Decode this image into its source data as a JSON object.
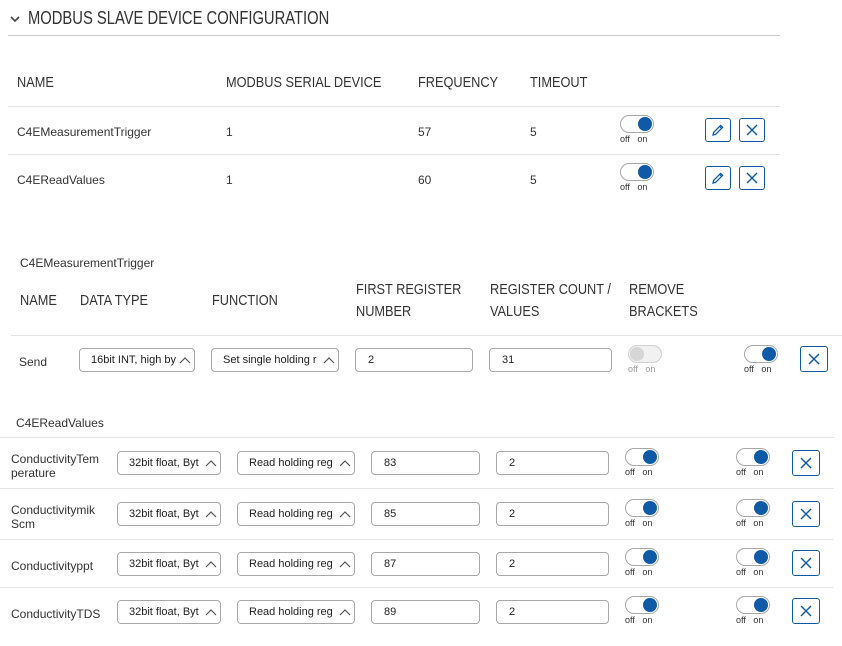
{
  "section": {
    "title": "MODBUS SLAVE DEVICE CONFIGURATION"
  },
  "devices": {
    "headers": [
      "NAME",
      "MODBUS SERIAL DEVICE",
      "FREQUENCY",
      "TIMEOUT"
    ],
    "rows": [
      {
        "name": "C4EMeasurementTrigger",
        "serial": "1",
        "frequency": "57",
        "timeout": "5",
        "enabled": true
      },
      {
        "name": "C4EReadValues",
        "serial": "1",
        "frequency": "60",
        "timeout": "5",
        "enabled": true
      }
    ]
  },
  "toggle_labels": {
    "off": "off",
    "on": "on"
  },
  "trigger": {
    "title": "C4EMeasurementTrigger",
    "headers": {
      "name": "NAME",
      "data_type": "DATA TYPE",
      "function": "FUNCTION",
      "first_register_1": "FIRST REGISTER",
      "first_register_2": "NUMBER",
      "register_count_1": "REGISTER COUNT /",
      "register_count_2": "VALUES",
      "remove_brackets_1": "REMOVE",
      "remove_brackets_2": "BRACKETS"
    },
    "rows": [
      {
        "name": "Send",
        "data_type": "16bit INT, high by",
        "function": "Set single holding r",
        "first_register": "2",
        "register_count": "31",
        "remove_brackets": false,
        "enabled": true
      }
    ]
  },
  "readvalues": {
    "title": "C4EReadValues",
    "rows": [
      {
        "name_1": "ConductivityTem",
        "name_2": "perature",
        "data_type": "32bit float, Byt",
        "function": "Read holding reg",
        "first_register": "83",
        "register_count": "2",
        "remove_brackets": true,
        "enabled": true
      },
      {
        "name_1": "Conductivitymik",
        "name_2": "Scm",
        "data_type": "32bit float, Byt",
        "function": "Read holding reg",
        "first_register": "85",
        "register_count": "2",
        "remove_brackets": true,
        "enabled": true
      },
      {
        "name_1": "Conductivityppt",
        "name_2": "",
        "data_type": "32bit float, Byt",
        "function": "Read holding reg",
        "first_register": "87",
        "register_count": "2",
        "remove_brackets": true,
        "enabled": true
      },
      {
        "name_1": "ConductivityTDS",
        "name_2": "",
        "data_type": "32bit float, Byt",
        "function": "Read holding reg",
        "first_register": "89",
        "register_count": "2",
        "remove_brackets": true,
        "enabled": true
      }
    ]
  },
  "colors": {
    "accent": "#0e5aa7",
    "divider": "#c8c8c8",
    "row_line": "#e3e3e3"
  },
  "icons": {
    "section_toggle": "chevron-down-icon",
    "edit": "pencil-icon",
    "delete": "close-icon",
    "select_arrow": "chevron-up-icon"
  }
}
